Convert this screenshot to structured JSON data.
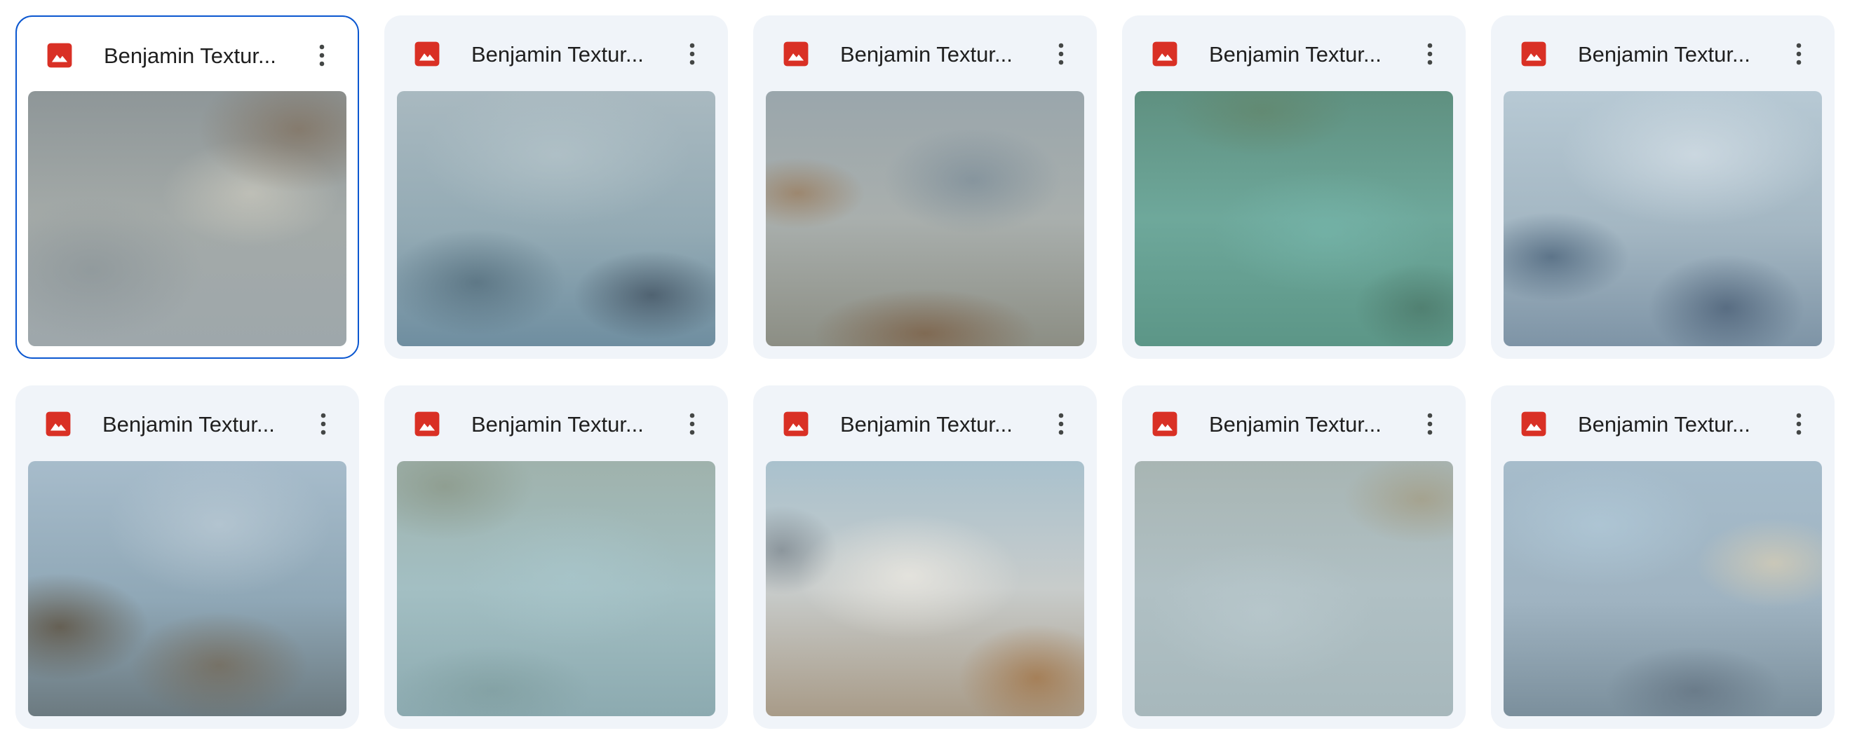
{
  "colors": {
    "card_bg": "#f0f4f9",
    "selected_border": "#0b57d0",
    "image_icon": "#d93025",
    "text": "#1f1f1f"
  },
  "files": [
    {
      "name": "Benjamin Textur...",
      "icon": "image-icon",
      "selected": true
    },
    {
      "name": "Benjamin Textur...",
      "icon": "image-icon",
      "selected": false
    },
    {
      "name": "Benjamin Textur...",
      "icon": "image-icon",
      "selected": false
    },
    {
      "name": "Benjamin Textur...",
      "icon": "image-icon",
      "selected": false
    },
    {
      "name": "Benjamin Textur...",
      "icon": "image-icon",
      "selected": false
    },
    {
      "name": "Benjamin Textur...",
      "icon": "image-icon",
      "selected": false
    },
    {
      "name": "Benjamin Textur...",
      "icon": "image-icon",
      "selected": false
    },
    {
      "name": "Benjamin Textur...",
      "icon": "image-icon",
      "selected": false
    },
    {
      "name": "Benjamin Textur...",
      "icon": "image-icon",
      "selected": false
    },
    {
      "name": "Benjamin Textur...",
      "icon": "image-icon",
      "selected": false
    }
  ]
}
